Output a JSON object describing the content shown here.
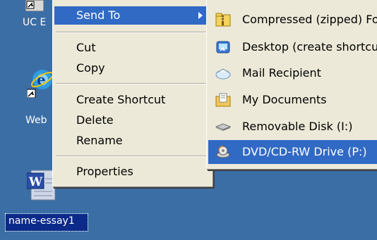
{
  "desktop": {
    "icons": [
      {
        "label": "UC E"
      },
      {
        "label": "Web"
      },
      {
        "label": "name-essay1"
      }
    ]
  },
  "context_menu": {
    "send_to": "Send To",
    "cut": "Cut",
    "copy": "Copy",
    "create_shortcut": "Create Shortcut",
    "delete": "Delete",
    "rename": "Rename",
    "properties": "Properties"
  },
  "send_to_menu": {
    "items": [
      {
        "label": "Compressed (zipped) Fo",
        "icon": "zip-folder-icon"
      },
      {
        "label": "Desktop (create shortcu",
        "icon": "desktop-icon"
      },
      {
        "label": "Mail Recipient",
        "icon": "mail-envelope-icon"
      },
      {
        "label": "My Documents",
        "icon": "folder-documents-icon"
      },
      {
        "label": "Removable Disk (I:)",
        "icon": "removable-disk-icon"
      },
      {
        "label": "DVD/CD-RW Drive (P:)",
        "icon": "dvd-drive-icon"
      }
    ]
  },
  "colors": {
    "desktop_bg": "#3a6ea5",
    "menu_bg": "#ece9d8",
    "highlight": "#316ac5"
  }
}
